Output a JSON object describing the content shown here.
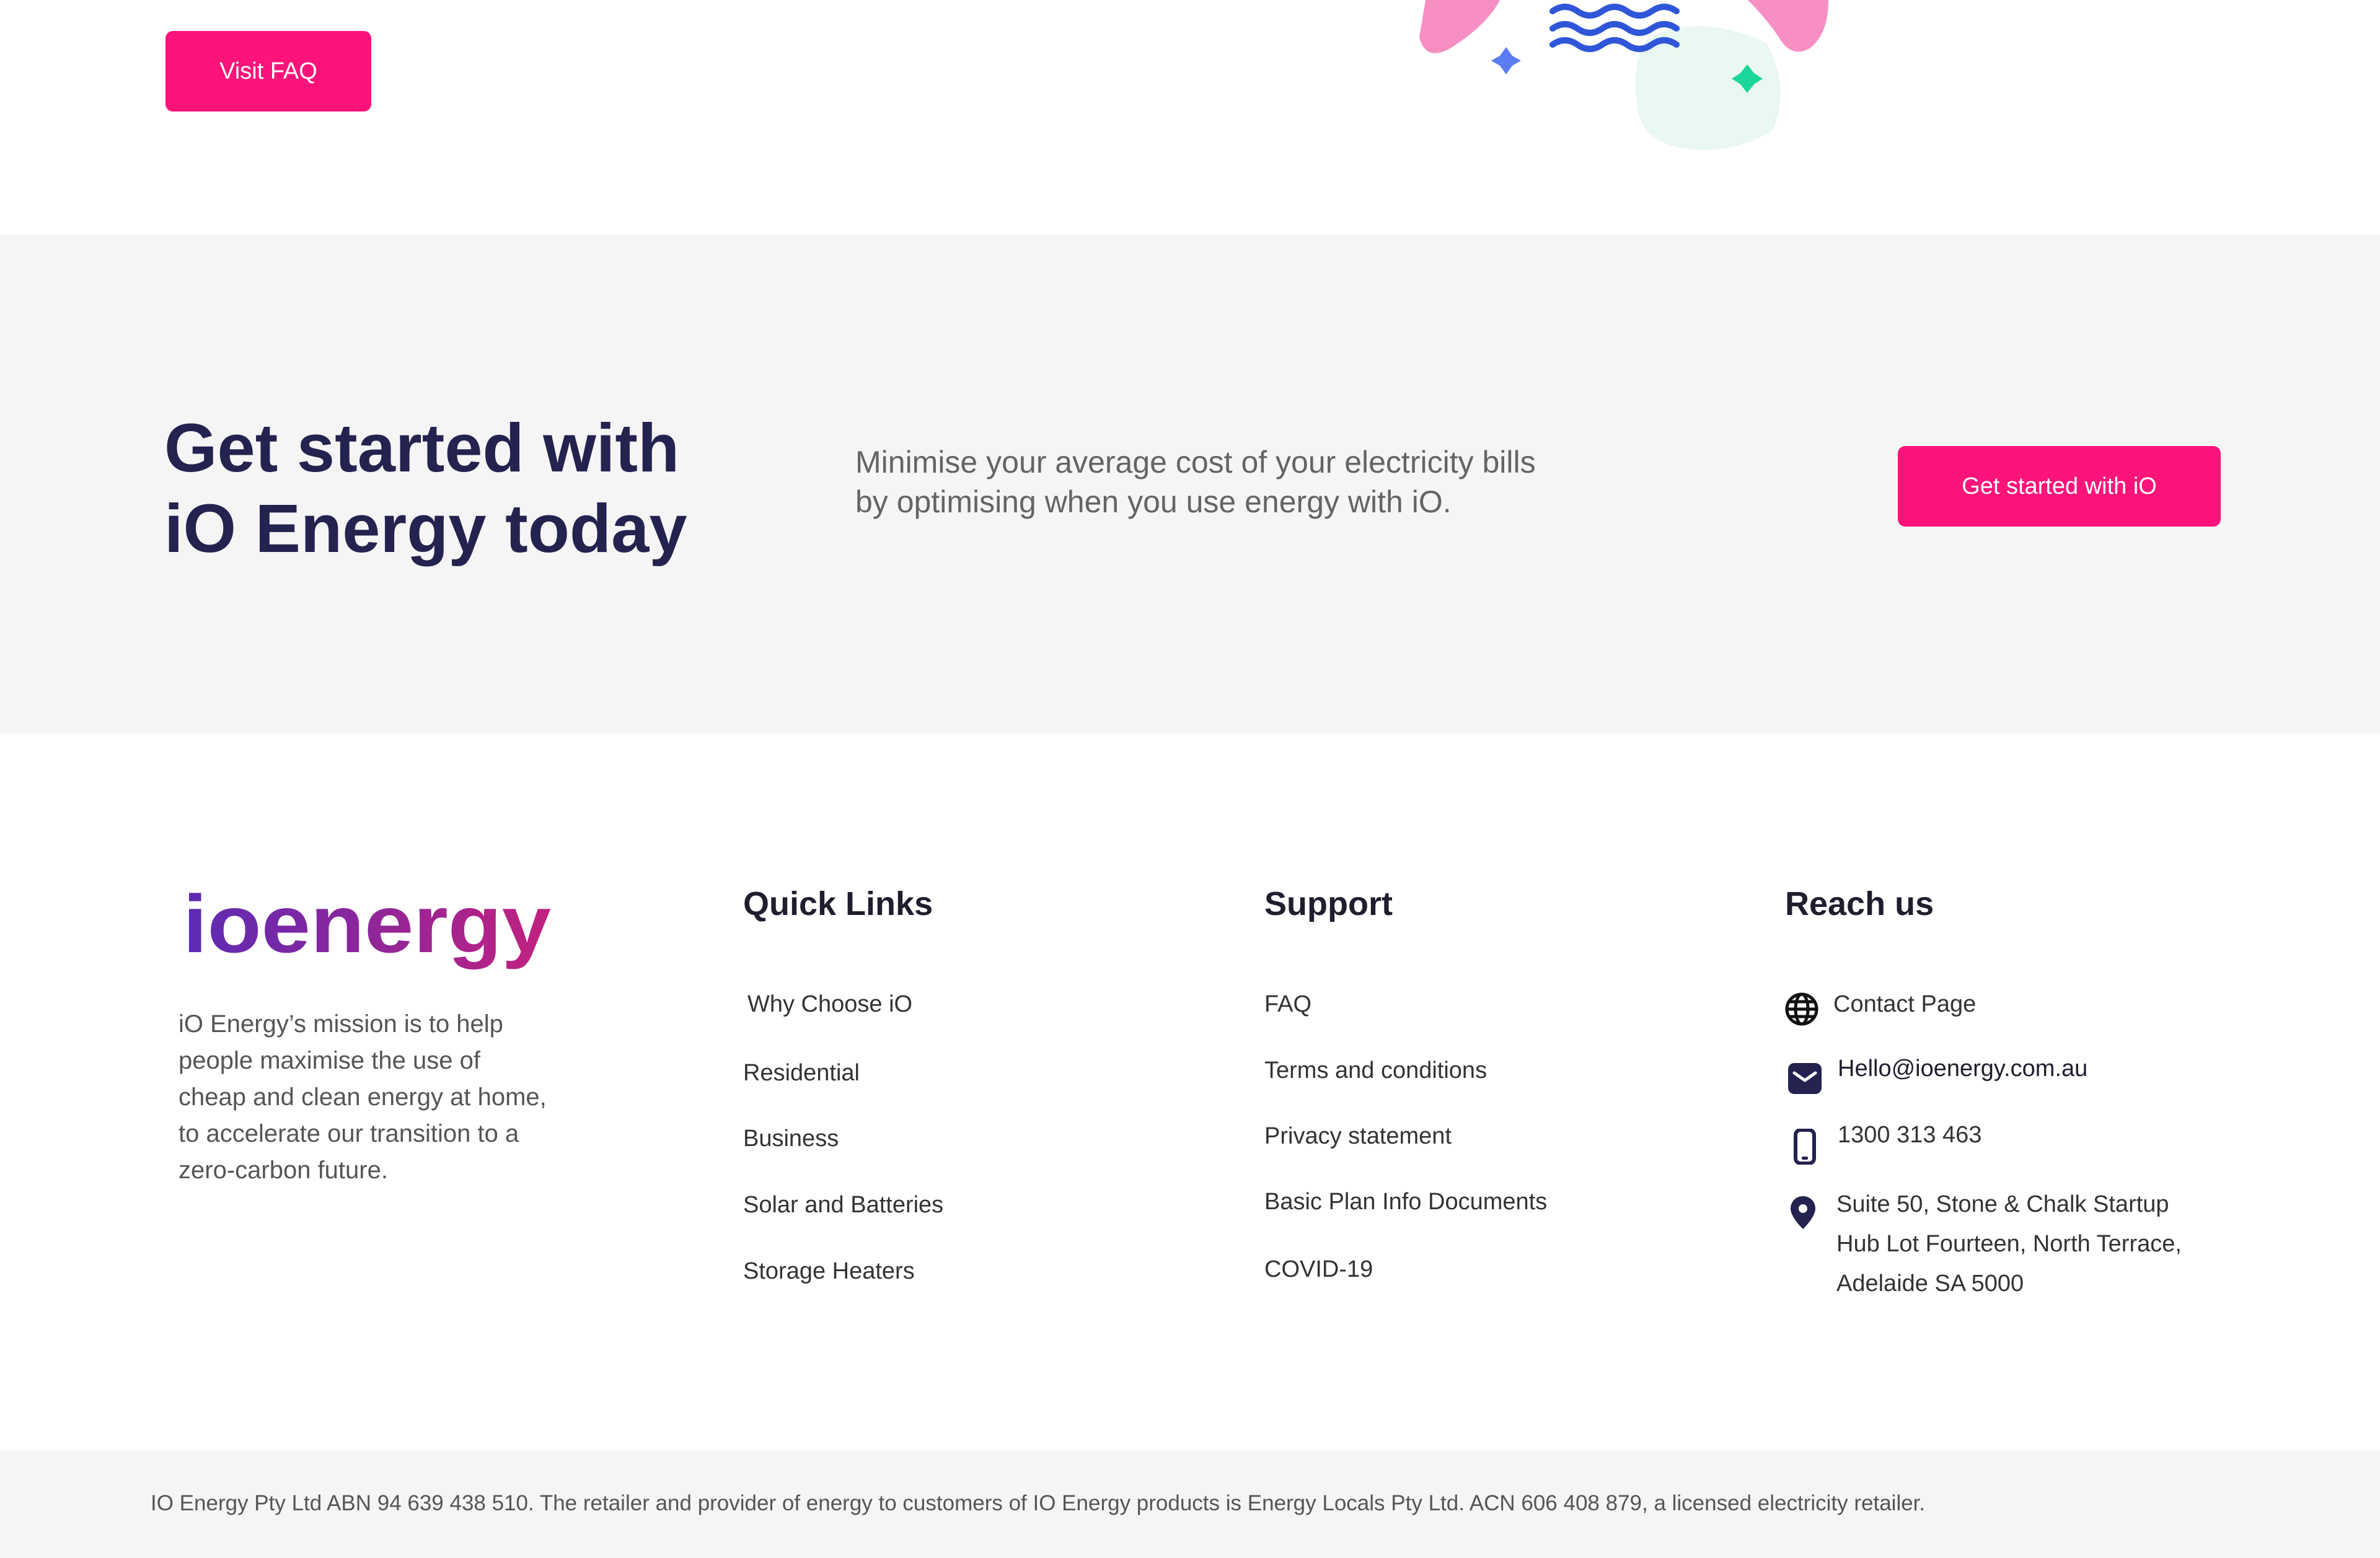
{
  "top": {
    "faq_button": "Visit FAQ"
  },
  "cta": {
    "title_line1": "Get started with",
    "title_line2": "iO Energy today",
    "text_line1": "Minimise your average cost of your electricity bills",
    "text_line2": "by optimising when you use energy with iO.",
    "button": "Get started with iO"
  },
  "footer": {
    "logo_text": "ioenergy",
    "mission_lines": [
      "iO Energy’s mission is to help",
      "people maximise the use of",
      "cheap and clean energy at home,",
      "to accelerate our transition to a",
      "zero-carbon future."
    ],
    "quick_links": {
      "title": "Quick Links",
      "items": [
        "Why Choose iO",
        "Residential",
        "Business",
        "Solar and Batteries",
        "Storage Heaters"
      ]
    },
    "support": {
      "title": "Support",
      "items": [
        "FAQ",
        "Terms and conditions",
        "Privacy statement",
        "Basic Plan Info Documents",
        "COVID-19"
      ]
    },
    "reach_us": {
      "title": "Reach us",
      "contact_page": "Contact Page",
      "email": "Hello@ioenergy.com.au",
      "phone": "1300 313 463",
      "address_lines": [
        "Suite 50, Stone & Chalk Startup",
        "Hub Lot Fourteen, North Terrace,",
        "Adelaide SA 5000"
      ],
      "icons": [
        "globe-icon",
        "mail-icon",
        "phone-icon",
        "location-pin-icon"
      ]
    },
    "legal": "IO Energy Pty Ltd ABN 94 639 438 510. The retailer and provider of energy to customers of IO Energy products is Energy Locals Pty Ltd. ACN 606 408 879, a licensed electricity retailer."
  },
  "colors": {
    "accent_pink": "#fd1379",
    "heading_navy": "#24224f",
    "band_gray": "#f5f5f5",
    "logo_gradient_start": "#5b2bb5",
    "logo_gradient_end": "#c2217f"
  }
}
